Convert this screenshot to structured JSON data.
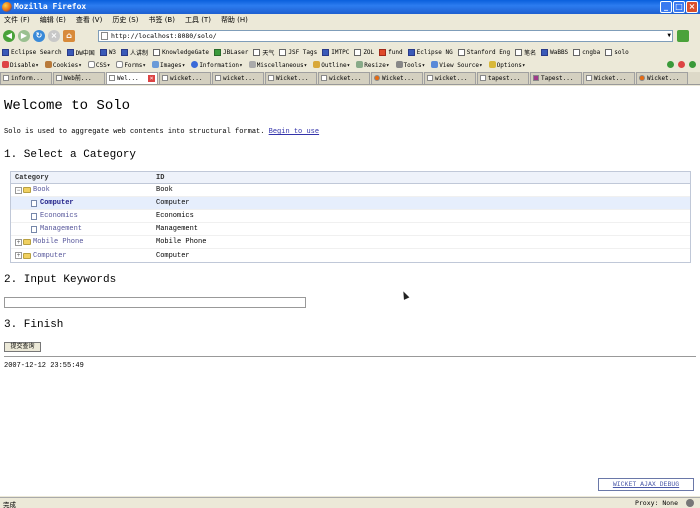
{
  "window": {
    "title": "Mozilla Firefox"
  },
  "menu": [
    "文件 (F)",
    "编辑 (E)",
    "查看 (V)",
    "历史 (S)",
    "书签 (B)",
    "工具 (T)",
    "帮助 (H)"
  ],
  "url": "http://localhost:8080/solo/",
  "bookmarks": [
    "Eclipse Search",
    "DW中国",
    "W3",
    "人讲制",
    "KnowledgeGate",
    "JBLaser",
    "天气",
    "JSF Tags",
    "IMTPC",
    "ZOL",
    "fund",
    "Eclipse NG",
    "Stanford Eng",
    "笔名",
    "WaBBS",
    "cngba",
    "solo"
  ],
  "devbar": [
    "Disable",
    "Cookies",
    "CSS",
    "Forms",
    "Images",
    "Information",
    "Miscellaneous",
    "Outline",
    "Resize",
    "Tools",
    "View Source",
    "Options"
  ],
  "tabs": [
    "inform...",
    "Web前...",
    "Wel...",
    "wicket...",
    "wicket...",
    "Wicket...",
    "wicket...",
    "Wicket...",
    "wicket...",
    "tapest...",
    "Tapest...",
    "Wicket...",
    "Wicket..."
  ],
  "page": {
    "heading": "Welcome to Solo",
    "intro_text": "Solo is used to aggregate web contents into structural format.",
    "intro_link": "Begin to use",
    "section1": "1. Select a Category",
    "section2": "2. Input Keywords",
    "section3": "3. Finish",
    "submit_label": "提交查询",
    "timestamp": "2007-12-12 23:55:49",
    "ajax_debug": "WICKET AJAX DEBUG"
  },
  "tree": {
    "headers": {
      "category": "Category",
      "id": "ID"
    },
    "rows": [
      {
        "category": "Book",
        "id": "Book"
      },
      {
        "category": "Computer",
        "id": "Computer"
      },
      {
        "category": "Economics",
        "id": "Economics"
      },
      {
        "category": "Management",
        "id": "Management"
      },
      {
        "category": "Mobile Phone",
        "id": "Mobile Phone"
      },
      {
        "category": "Computer",
        "id": "Computer"
      }
    ]
  },
  "status": {
    "left": "完成",
    "right": "Proxy: None"
  }
}
